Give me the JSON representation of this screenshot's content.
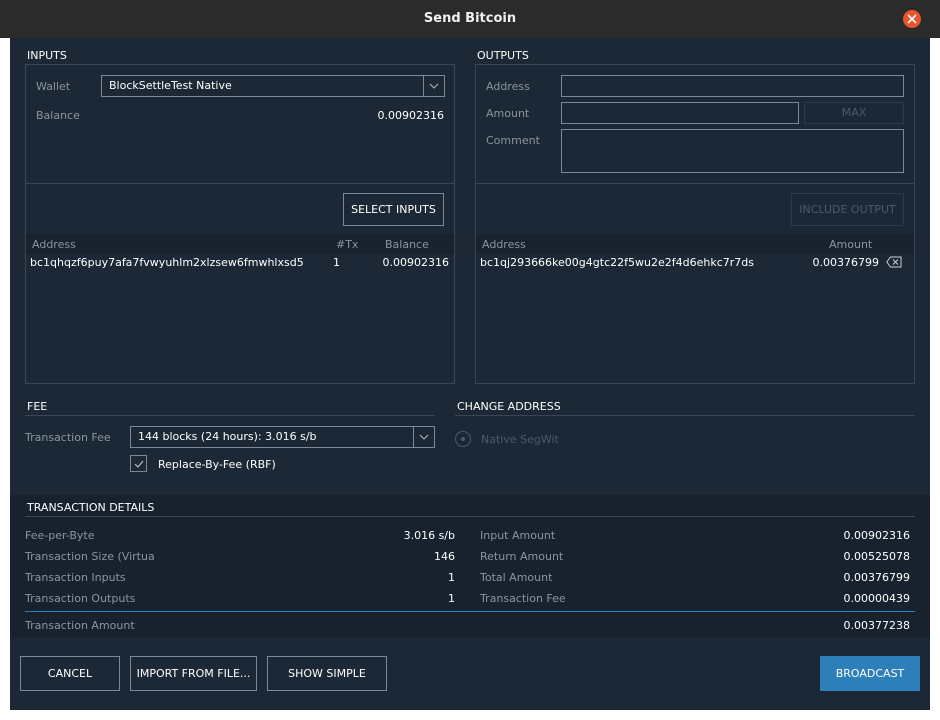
{
  "window": {
    "title": "Send Bitcoin"
  },
  "inputs": {
    "section_title": "INPUTS",
    "wallet_label": "Wallet",
    "wallet_value": "BlockSettleTest Native",
    "balance_label": "Balance",
    "balance_value": "0.00902316",
    "select_inputs_label": "SELECT INPUTS",
    "columns": [
      "Address",
      "#Tx",
      "Balance"
    ],
    "rows": [
      {
        "address": "bc1qhqzf6puy7afa7fvwyuhlm2xlzsew6fmwhlxsd5",
        "tx": "1",
        "balance": "0.00902316"
      }
    ]
  },
  "outputs": {
    "section_title": "OUTPUTS",
    "address_label": "Address",
    "address_value": "",
    "amount_label": "Amount",
    "amount_value": "",
    "max_label": "MAX",
    "comment_label": "Comment",
    "comment_value": "",
    "include_output_label": "INCLUDE OUTPUT",
    "columns": [
      "Address",
      "Amount"
    ],
    "rows": [
      {
        "address": "bc1qj293666ke00g4gtc22f5wu2e2f4d6ehkc7r7ds",
        "amount": "0.00376799"
      }
    ]
  },
  "fee": {
    "section_title": "FEE",
    "transaction_fee_label": "Transaction Fee",
    "transaction_fee_value": "144 blocks (24 hours): 3.016 s/b",
    "rbf_label": "Replace-By-Fee (RBF)",
    "rbf_checked": true
  },
  "change_address": {
    "section_title": "CHANGE ADDRESS",
    "option_label": "Native SegWit"
  },
  "details": {
    "section_title": "TRANSACTION DETAILS",
    "left": [
      {
        "label": "Fee-per-Byte",
        "value": "3.016 s/b"
      },
      {
        "label": "Transaction Size (Virtua",
        "value": "146"
      },
      {
        "label": "Transaction Inputs",
        "value": "1"
      },
      {
        "label": "Transaction Outputs",
        "value": "1"
      }
    ],
    "right": [
      {
        "label": "Input Amount",
        "value": "0.00902316"
      },
      {
        "label": "Return Amount",
        "value": "0.00525078"
      },
      {
        "label": "Total Amount",
        "value": "0.00376799"
      },
      {
        "label": "Transaction Fee",
        "value": "0.00000439"
      }
    ],
    "total_label": "Transaction Amount",
    "total_value": "0.00377238"
  },
  "footer": {
    "cancel_label": "CANCEL",
    "import_label": "IMPORT FROM FILE...",
    "show_simple_label": "SHOW SIMPLE",
    "broadcast_label": "BROADCAST"
  },
  "colors": {
    "background": "#1c2836",
    "accent": "#2c7fb8",
    "close": "#e9542c"
  }
}
